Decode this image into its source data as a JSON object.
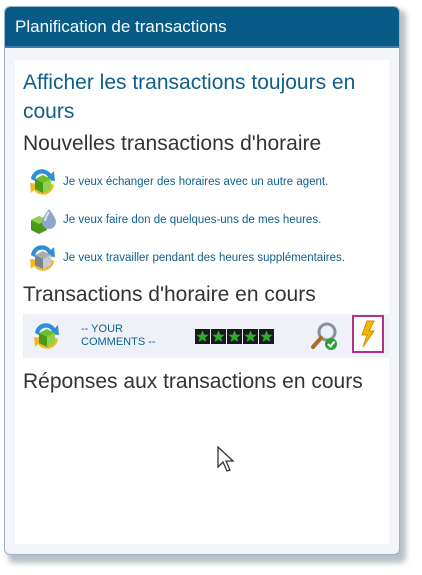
{
  "window": {
    "title": "Planification de transactions"
  },
  "links": {
    "show_open": "Afficher les transactions toujours en cours"
  },
  "sections": {
    "new": "Nouvelles transactions d'horaire",
    "open": "Transactions d'horaire en cours",
    "responses": "Réponses aux transactions en cours"
  },
  "new_items": [
    {
      "label": "Je veux échanger des horaires avec un autre agent.",
      "icon": "swap-shifts-icon"
    },
    {
      "label": "Je veux faire don de quelques-uns de mes heures.",
      "icon": "give-hours-icon"
    },
    {
      "label": "Je veux travailler pendant des heures supplémentaires.",
      "icon": "overtime-icon"
    }
  ],
  "open_trade": {
    "comment": "-- YOUR COMMENTS --",
    "rating": 5,
    "rating_max": 5,
    "icon": "swap-shifts-icon"
  },
  "colors": {
    "header": "#085b87",
    "link": "#0f5f8c",
    "highlight_border": "#b2318a",
    "star": "#2faa2f"
  }
}
